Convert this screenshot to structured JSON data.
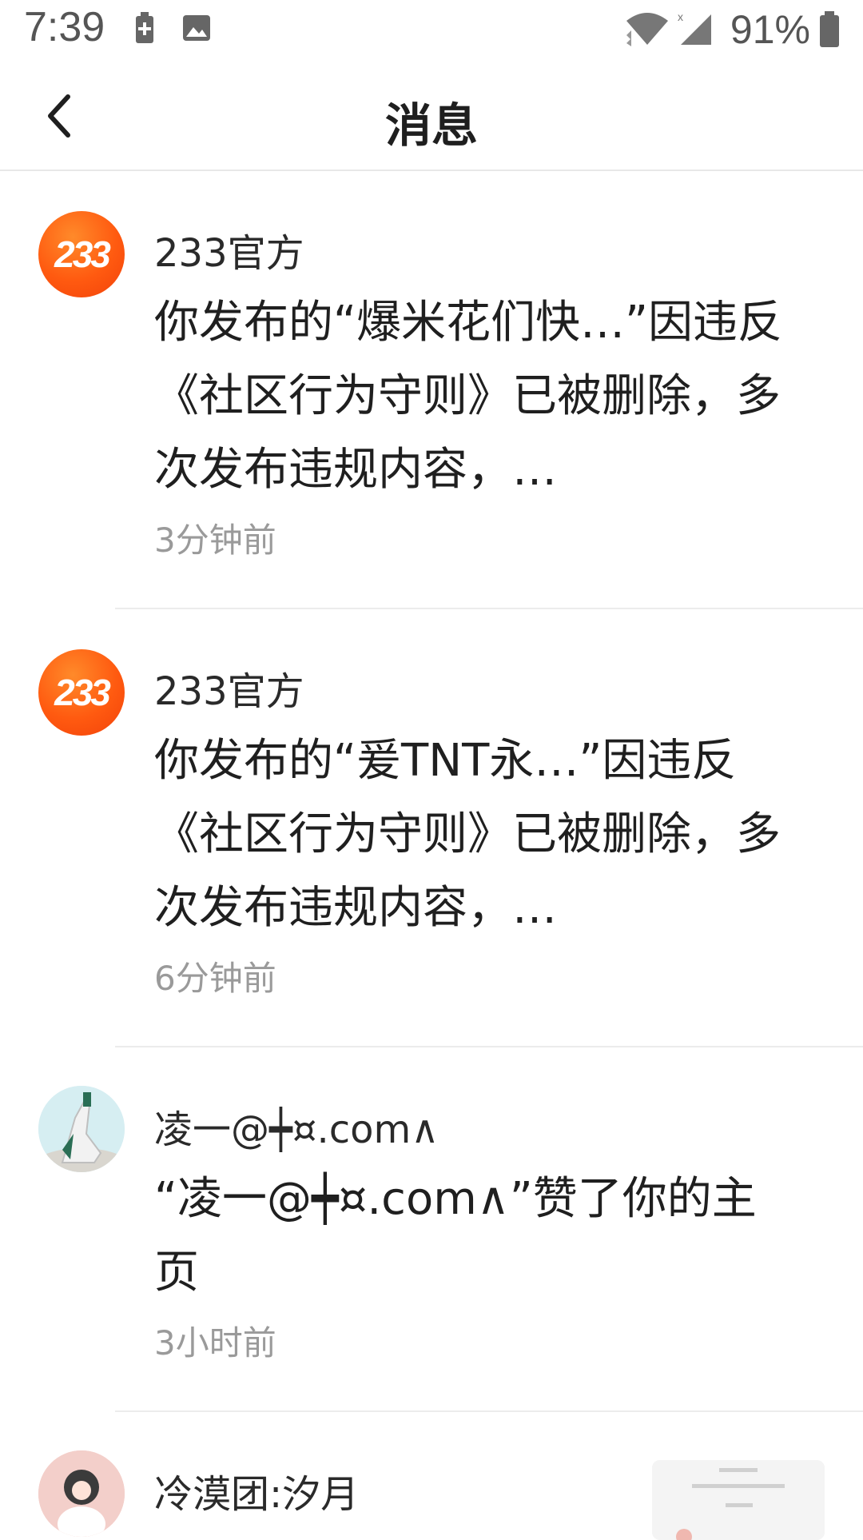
{
  "status_bar": {
    "time": "7:39",
    "battery_percent": "91%",
    "icons": [
      "battery-saver-icon",
      "image-icon",
      "wifi-icon",
      "signal-icon",
      "battery-icon"
    ]
  },
  "nav": {
    "title": "消息",
    "back_icon": "chevron-left-icon"
  },
  "messages": [
    {
      "sender": "233官方",
      "avatar_text": "233",
      "text": "你发布的“爆米花们快…”因违反《社区行为守则》已被删除，多次发布违规内容，…",
      "time": "3分钟前"
    },
    {
      "sender": "233官方",
      "avatar_text": "233",
      "text": "你发布的“爰TNT永…”因违反《社区行为守则》已被删除，多次发布违规内容，…",
      "time": "6分钟前"
    },
    {
      "sender": "凌一@┿¤.com∧",
      "text": "“凌一@┿¤.com∧”赞了你的主页",
      "time": "3小时前"
    },
    {
      "sender": "冷漠团:汐月"
    }
  ],
  "colors": {
    "accent": "#ff5a10",
    "time_gray": "#9a9a9a",
    "divider": "#ececec"
  }
}
